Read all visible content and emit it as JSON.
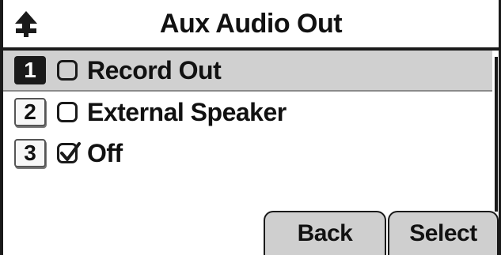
{
  "title": "Aux Audio Out",
  "menu": {
    "items": [
      {
        "index": "1",
        "label": "Record Out",
        "checked": false,
        "selected": true
      },
      {
        "index": "2",
        "label": "External Speaker",
        "checked": false,
        "selected": false
      },
      {
        "index": "3",
        "label": "Off",
        "checked": true,
        "selected": false
      }
    ]
  },
  "softkeys": {
    "back": "Back",
    "select": "Select"
  },
  "icons": {
    "title": "arrow-up-pin-icon",
    "checkbox_checked": "checkbox-checked-icon",
    "checkbox_unchecked": "checkbox-unchecked-icon"
  },
  "colors": {
    "highlight": "#d0d0d0",
    "frame": "#1a1a1a",
    "softkey": "#cfcfcf"
  }
}
